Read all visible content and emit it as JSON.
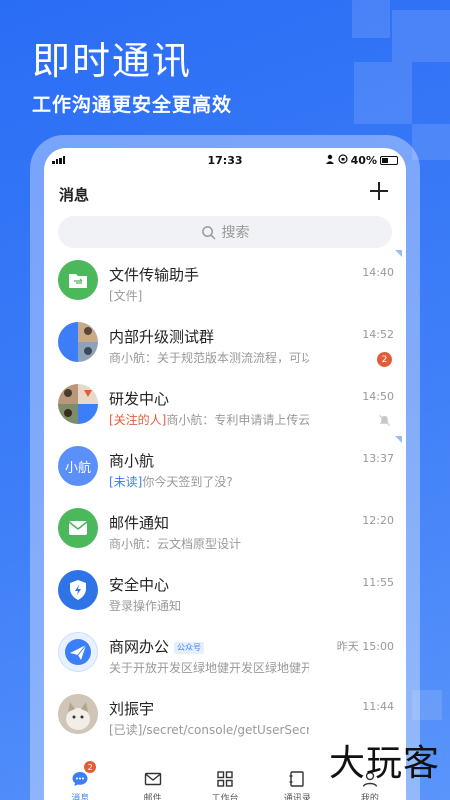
{
  "hero": {
    "title": "即时通讯",
    "subtitle": "工作沟通更安全更高效"
  },
  "status_bar": {
    "time": "17:33",
    "battery": "40%"
  },
  "header": {
    "title": "消息"
  },
  "search": {
    "placeholder": "搜索"
  },
  "messages": [
    {
      "name": "文件传输助手",
      "preview": "[文件]",
      "time": "14:40"
    },
    {
      "name": "内部升级测试群",
      "preview": "商小航：关于规范版本测流流程，可以使工...",
      "time": "14:52",
      "badge": "2"
    },
    {
      "name": "研发中心",
      "tag": "[关注的人]",
      "preview": "商小航：专利申请请上传云文档...",
      "time": "14:50"
    },
    {
      "name": "商小航",
      "avatar_text": "小航",
      "tag": "[未读]",
      "preview": "你今天签到了没?",
      "time": "13:37"
    },
    {
      "name": "邮件通知",
      "preview": "商小航：云文档原型设计",
      "time": "12:20"
    },
    {
      "name": "安全中心",
      "preview": "登录操作通知",
      "time": "11:55"
    },
    {
      "name": "商网办公",
      "official_tag": "公众号",
      "preview": "关于开放开发区绿地健开发区绿地健开发...",
      "time": "昨天 15:00"
    },
    {
      "name": "刘振宇",
      "preview": "[已读]/secret/console/getUserSecretList",
      "time": "11:44"
    }
  ],
  "tabs": [
    {
      "label": "消息",
      "badge": "2"
    },
    {
      "label": "邮件"
    },
    {
      "label": "工作台"
    },
    {
      "label": "通讯录"
    },
    {
      "label": "我的"
    }
  ],
  "watermark": "大玩客",
  "colors": {
    "brand": "#3b7ef8",
    "green": "#4cb85c",
    "badge_red": "#e35c3a"
  }
}
